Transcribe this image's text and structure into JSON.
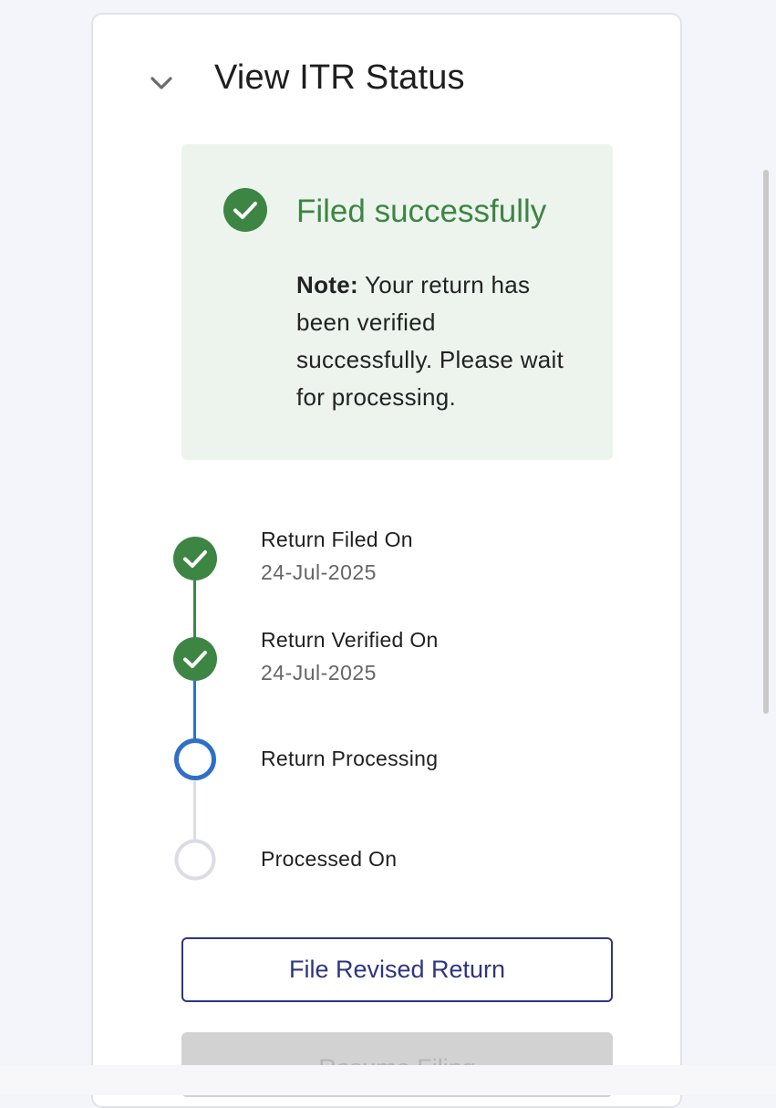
{
  "header": {
    "title": "View ITR Status"
  },
  "status": {
    "title": "Filed successfully",
    "note_label": "Note:",
    "note_text": " Your return has been verified successfully. Please wait for processing."
  },
  "timeline": [
    {
      "label": "Return Filed On",
      "date": "24-Jul-2025",
      "state": "done"
    },
    {
      "label": "Return Verified On",
      "date": "24-Jul-2025",
      "state": "done"
    },
    {
      "label": "Return Processing",
      "date": "",
      "state": "current"
    },
    {
      "label": "Processed On",
      "date": "",
      "state": "pending"
    }
  ],
  "actions": {
    "file_revised": "File Revised Return",
    "resume_filing": "Resume Filing"
  },
  "colors": {
    "success": "#3d8543",
    "current": "#2f6fc9",
    "pending": "#dcdce6",
    "primary": "#2f3580"
  }
}
